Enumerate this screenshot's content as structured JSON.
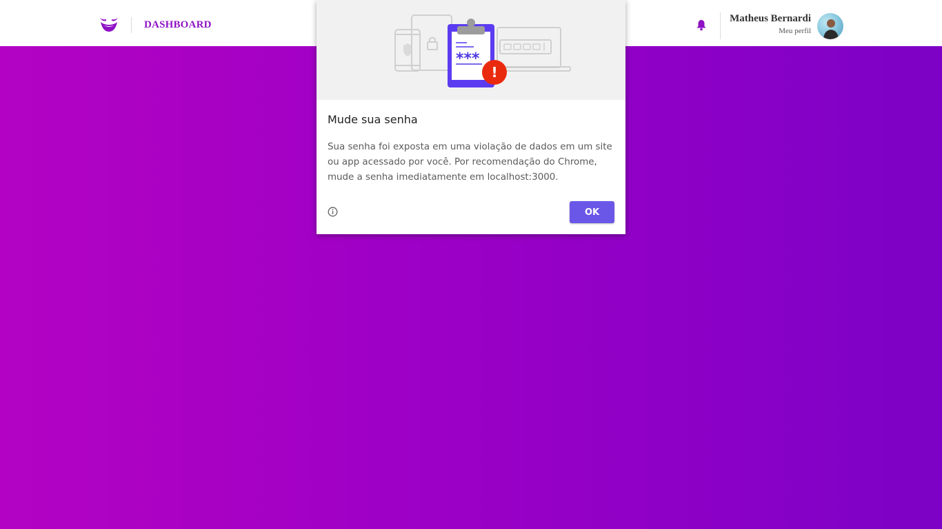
{
  "header": {
    "brand": "DASHBOARD",
    "logo_icon": "mustache-logo-icon",
    "notification_icon": "bell-icon",
    "user": {
      "name": "Matheus Bernardi",
      "subtitle": "Meu perfil"
    }
  },
  "dialog": {
    "title": "Mude sua senha",
    "body_lines": [
      "Sua senha foi exposta em uma violação de dados em um site",
      "ou app acessado por você. Por recomendação do Chrome,",
      "mude a senha imediatamente em localhost:3000."
    ],
    "illustration_mask": "***",
    "illustration_alert": "!",
    "info_icon": "info-icon",
    "ok_label": "OK"
  },
  "colors": {
    "accent": "#8e12c4",
    "button": "#6a57e8",
    "alert": "#ea2a0e",
    "background_start": "#b302c3",
    "background_end": "#7d01c6"
  }
}
